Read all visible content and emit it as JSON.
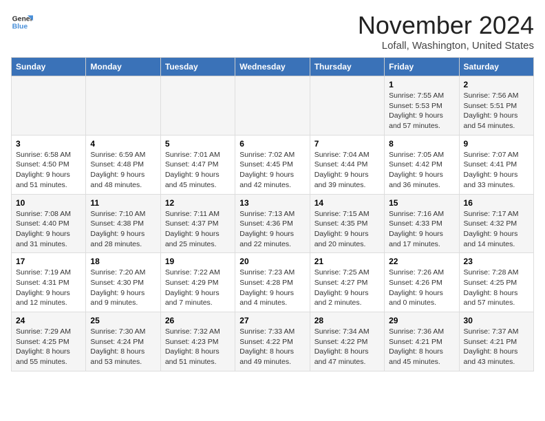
{
  "logo": {
    "line1": "General",
    "line2": "Blue"
  },
  "title": "November 2024",
  "location": "Lofall, Washington, United States",
  "weekdays": [
    "Sunday",
    "Monday",
    "Tuesday",
    "Wednesday",
    "Thursday",
    "Friday",
    "Saturday"
  ],
  "weeks": [
    [
      {
        "day": "",
        "info": ""
      },
      {
        "day": "",
        "info": ""
      },
      {
        "day": "",
        "info": ""
      },
      {
        "day": "",
        "info": ""
      },
      {
        "day": "",
        "info": ""
      },
      {
        "day": "1",
        "info": "Sunrise: 7:55 AM\nSunset: 5:53 PM\nDaylight: 9 hours and 57 minutes."
      },
      {
        "day": "2",
        "info": "Sunrise: 7:56 AM\nSunset: 5:51 PM\nDaylight: 9 hours and 54 minutes."
      }
    ],
    [
      {
        "day": "3",
        "info": "Sunrise: 6:58 AM\nSunset: 4:50 PM\nDaylight: 9 hours and 51 minutes."
      },
      {
        "day": "4",
        "info": "Sunrise: 6:59 AM\nSunset: 4:48 PM\nDaylight: 9 hours and 48 minutes."
      },
      {
        "day": "5",
        "info": "Sunrise: 7:01 AM\nSunset: 4:47 PM\nDaylight: 9 hours and 45 minutes."
      },
      {
        "day": "6",
        "info": "Sunrise: 7:02 AM\nSunset: 4:45 PM\nDaylight: 9 hours and 42 minutes."
      },
      {
        "day": "7",
        "info": "Sunrise: 7:04 AM\nSunset: 4:44 PM\nDaylight: 9 hours and 39 minutes."
      },
      {
        "day": "8",
        "info": "Sunrise: 7:05 AM\nSunset: 4:42 PM\nDaylight: 9 hours and 36 minutes."
      },
      {
        "day": "9",
        "info": "Sunrise: 7:07 AM\nSunset: 4:41 PM\nDaylight: 9 hours and 33 minutes."
      }
    ],
    [
      {
        "day": "10",
        "info": "Sunrise: 7:08 AM\nSunset: 4:40 PM\nDaylight: 9 hours and 31 minutes."
      },
      {
        "day": "11",
        "info": "Sunrise: 7:10 AM\nSunset: 4:38 PM\nDaylight: 9 hours and 28 minutes."
      },
      {
        "day": "12",
        "info": "Sunrise: 7:11 AM\nSunset: 4:37 PM\nDaylight: 9 hours and 25 minutes."
      },
      {
        "day": "13",
        "info": "Sunrise: 7:13 AM\nSunset: 4:36 PM\nDaylight: 9 hours and 22 minutes."
      },
      {
        "day": "14",
        "info": "Sunrise: 7:15 AM\nSunset: 4:35 PM\nDaylight: 9 hours and 20 minutes."
      },
      {
        "day": "15",
        "info": "Sunrise: 7:16 AM\nSunset: 4:33 PM\nDaylight: 9 hours and 17 minutes."
      },
      {
        "day": "16",
        "info": "Sunrise: 7:17 AM\nSunset: 4:32 PM\nDaylight: 9 hours and 14 minutes."
      }
    ],
    [
      {
        "day": "17",
        "info": "Sunrise: 7:19 AM\nSunset: 4:31 PM\nDaylight: 9 hours and 12 minutes."
      },
      {
        "day": "18",
        "info": "Sunrise: 7:20 AM\nSunset: 4:30 PM\nDaylight: 9 hours and 9 minutes."
      },
      {
        "day": "19",
        "info": "Sunrise: 7:22 AM\nSunset: 4:29 PM\nDaylight: 9 hours and 7 minutes."
      },
      {
        "day": "20",
        "info": "Sunrise: 7:23 AM\nSunset: 4:28 PM\nDaylight: 9 hours and 4 minutes."
      },
      {
        "day": "21",
        "info": "Sunrise: 7:25 AM\nSunset: 4:27 PM\nDaylight: 9 hours and 2 minutes."
      },
      {
        "day": "22",
        "info": "Sunrise: 7:26 AM\nSunset: 4:26 PM\nDaylight: 9 hours and 0 minutes."
      },
      {
        "day": "23",
        "info": "Sunrise: 7:28 AM\nSunset: 4:25 PM\nDaylight: 8 hours and 57 minutes."
      }
    ],
    [
      {
        "day": "24",
        "info": "Sunrise: 7:29 AM\nSunset: 4:25 PM\nDaylight: 8 hours and 55 minutes."
      },
      {
        "day": "25",
        "info": "Sunrise: 7:30 AM\nSunset: 4:24 PM\nDaylight: 8 hours and 53 minutes."
      },
      {
        "day": "26",
        "info": "Sunrise: 7:32 AM\nSunset: 4:23 PM\nDaylight: 8 hours and 51 minutes."
      },
      {
        "day": "27",
        "info": "Sunrise: 7:33 AM\nSunset: 4:22 PM\nDaylight: 8 hours and 49 minutes."
      },
      {
        "day": "28",
        "info": "Sunrise: 7:34 AM\nSunset: 4:22 PM\nDaylight: 8 hours and 47 minutes."
      },
      {
        "day": "29",
        "info": "Sunrise: 7:36 AM\nSunset: 4:21 PM\nDaylight: 8 hours and 45 minutes."
      },
      {
        "day": "30",
        "info": "Sunrise: 7:37 AM\nSunset: 4:21 PM\nDaylight: 8 hours and 43 minutes."
      }
    ]
  ]
}
